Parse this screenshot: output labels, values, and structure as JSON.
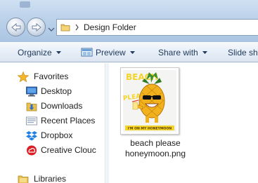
{
  "address": {
    "path": "Design Folder"
  },
  "toolbar": {
    "organize_label": "Organize",
    "preview_label": "Preview",
    "share_label": "Share with",
    "slide_label": "Slide sho"
  },
  "nav": {
    "favorites_label": "Favorites",
    "items": [
      {
        "label": "Desktop",
        "icon": "desktop-icon"
      },
      {
        "label": "Downloads",
        "icon": "downloads-icon"
      },
      {
        "label": "Recent Places",
        "icon": "recent-places-icon"
      },
      {
        "label": "Dropbox",
        "icon": "dropbox-icon"
      },
      {
        "label": "Creative Clouc",
        "icon": "creative-cloud-icon"
      }
    ],
    "libraries_label": "Libraries"
  },
  "file": {
    "name_line1": "beach please",
    "name_line2": "honeymoon.png",
    "thumb_text_top": "BEACH",
    "thumb_text_mid": "PLEAS",
    "thumb_text_bottom": "I'M ON MY HONEYMOON"
  },
  "colors": {
    "toolbar_text": "#1e395b",
    "titlebar_top": "#cfe0f2",
    "titlebar_bottom": "#aac5e3",
    "thumb_yellow": "#f4d428"
  }
}
